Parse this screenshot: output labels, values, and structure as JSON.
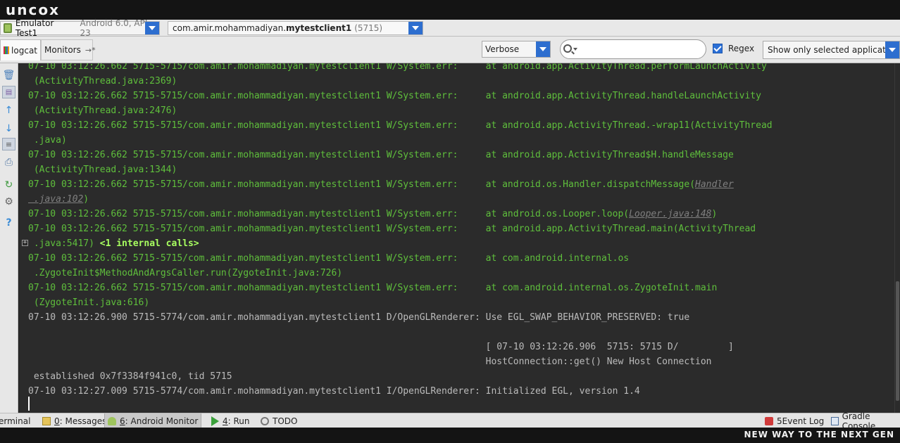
{
  "brand": {
    "logo": "uncox",
    "slogan": "NEW WAY TO THE NEXT GEN"
  },
  "device_bar": {
    "device_name": "Emulator Test1",
    "device_api": "Android 6.0, API 23",
    "process_package_prefix": "com.amir.mohammadiyan.",
    "process_package_bold": "mytestclient1",
    "process_pid": "(5715)"
  },
  "filter_bar": {
    "tab_logcat": "logcat",
    "tab_monitors": "Monitors",
    "tab_monitors_pin": "→*",
    "log_level": "Verbose",
    "search_value": "",
    "regex_label": "Regex",
    "regex_checked": true,
    "filter_option": "Show only selected application"
  },
  "log": {
    "lines": [
      "07-10 03:12:26.662 5715-5715/com.amir.mohammadiyan.mytestclient1 W/System.err:     at android.app.ActivityThread.performLaunchActivity",
      " (ActivityThread.java:2369)",
      "07-10 03:12:26.662 5715-5715/com.amir.mohammadiyan.mytestclient1 W/System.err:     at android.app.ActivityThread.handleLaunchActivity",
      " (ActivityThread.java:2476)",
      "07-10 03:12:26.662 5715-5715/com.amir.mohammadiyan.mytestclient1 W/System.err:     at android.app.ActivityThread.-wrap11(ActivityThread",
      " .java)",
      "07-10 03:12:26.662 5715-5715/com.amir.mohammadiyan.mytestclient1 W/System.err:     at android.app.ActivityThread$H.handleMessage",
      " (ActivityThread.java:1344)",
      "07-10 03:12:26.662 5715-5715/com.amir.mohammadiyan.mytestclient1 W/System.err:     at android.os.Handler.dispatchMessage(",
      "07-10 03:12:26.662 5715-5715/com.amir.mohammadiyan.mytestclient1 W/System.err:     at android.os.Looper.loop(",
      "07-10 03:12:26.662 5715-5715/com.amir.mohammadiyan.mytestclient1 W/System.err:     at android.app.ActivityThread.main(ActivityThread",
      " .java:5417) ",
      "07-10 03:12:26.662 5715-5715/com.amir.mohammadiyan.mytestclient1 W/System.err:     at com.android.internal.os",
      " .ZygoteInit$MethodAndArgsCaller.run(ZygoteInit.java:726)",
      "07-10 03:12:26.662 5715-5715/com.amir.mohammadiyan.mytestclient1 W/System.err:     at com.android.internal.os.ZygoteInit.main",
      " (ZygoteInit.java:616)",
      "07-10 03:12:26.900 5715-5774/com.amir.mohammadiyan.mytestclient1 D/OpenGLRenderer: Use EGL_SWAP_BEHAVIOR_PRESERVED: true",
      "                                                                                   [ 07-10 03:12:26.906  5715: 5715 D/         ]",
      "                                                                                   HostConnection::get() New Host Connection",
      " established 0x7f3384f941c0, tid 5715",
      "07-10 03:12:27.009 5715-5774/com.amir.mohammadiyan.mytestclient1 I/OpenGLRenderer: Initialized EGL, version 1.4"
    ],
    "handler_link": "Handler",
    "handler_link_line2": " .java:102",
    "handler_close": ")",
    "looper_link": "Looper.java:148",
    "looper_close": ")",
    "folded": "<1 internal calls>"
  },
  "bottom_bar": {
    "terminal": "erminal",
    "messages_key": "0",
    "messages": ": Messages",
    "monitor_key": "6",
    "monitor": ": Android Monitor",
    "run_key": "4",
    "run": ": Run",
    "todo": "TODO",
    "event_log_count": "5",
    "event_log": " Event Log",
    "gradle": "Gradle Console"
  },
  "colors": {
    "console_bg": "#2b2b2b",
    "warn_text": "#5fbf3c",
    "debug_text": "#bbbbbb",
    "accent": "#2d6ecf"
  },
  "icons": [
    "trash-icon",
    "scroll-to-end-icon",
    "up-arrow-icon",
    "down-arrow-icon",
    "soft-wrap-icon",
    "print-icon",
    "restart-icon",
    "settings-icon",
    "help-icon"
  ]
}
